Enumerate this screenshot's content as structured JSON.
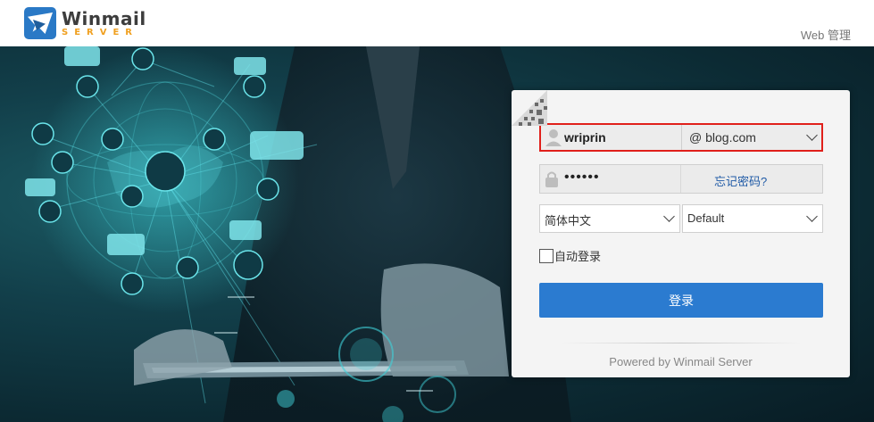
{
  "header": {
    "logo_word": "Winmail",
    "logo_sub": "SERVER",
    "web_admin_link": "Web 管理"
  },
  "login": {
    "username": "wriprin",
    "domain": "@ blog.com",
    "password_mask": "••••••",
    "forgot_password": "忘记密码?",
    "language": "简体中文",
    "theme": "Default",
    "auto_login_label": "自动登录",
    "auto_login_checked": false,
    "login_button": "登录",
    "powered_by": "Powered by Winmail Server"
  },
  "colors": {
    "brand_blue": "#2b7bd0",
    "highlight_border": "#e0201b",
    "logo_orange": "#f0a020",
    "link_blue": "#1f5aa6"
  },
  "icons": {
    "user": "user-icon",
    "lock": "lock-icon",
    "dropdown": "chevron-down-icon",
    "qr": "qr-code-icon"
  }
}
